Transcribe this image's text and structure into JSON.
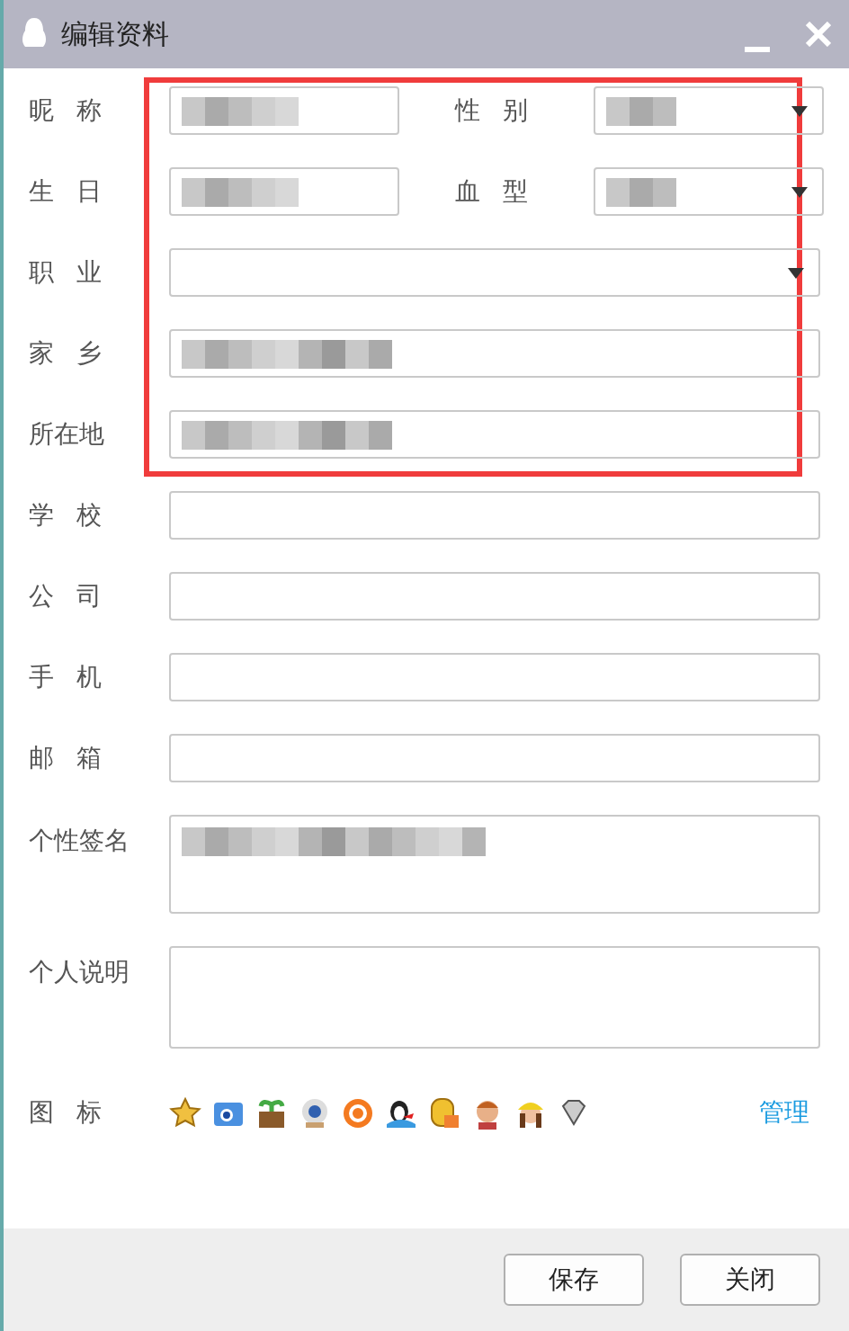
{
  "window": {
    "title": "编辑资料"
  },
  "highlight": true,
  "rows": [
    {
      "fields": [
        {
          "label": "昵 称",
          "kind": "text",
          "obscured": true
        },
        {
          "label": "性 别",
          "kind": "select",
          "obscured": true
        }
      ]
    },
    {
      "fields": [
        {
          "label": "生 日",
          "kind": "text",
          "obscured": true
        },
        {
          "label": "血 型",
          "kind": "select",
          "obscured": true
        }
      ]
    },
    {
      "fields": [
        {
          "label": "职 业",
          "kind": "select",
          "obscured": false
        }
      ]
    },
    {
      "fields": [
        {
          "label": "家 乡",
          "kind": "text",
          "obscured": true
        }
      ]
    },
    {
      "fields": [
        {
          "label": "所在地",
          "kind": "text",
          "obscured": true
        }
      ]
    },
    {
      "fields": [
        {
          "label": "学 校",
          "kind": "text",
          "obscured": false
        }
      ]
    },
    {
      "fields": [
        {
          "label": "公 司",
          "kind": "text",
          "obscured": false
        }
      ]
    },
    {
      "fields": [
        {
          "label": "手 机",
          "kind": "text",
          "obscured": false
        }
      ]
    },
    {
      "fields": [
        {
          "label": "邮 箱",
          "kind": "text",
          "obscured": false
        }
      ]
    },
    {
      "fields": [
        {
          "label": "个性签名",
          "kind": "textarea",
          "obscured": true
        }
      ]
    },
    {
      "fields": [
        {
          "label": "个人说明",
          "kind": "textarea",
          "obscured": false
        }
      ]
    }
  ],
  "icons": {
    "label": "图 标",
    "manage_link": "管理"
  },
  "buttons": [
    {
      "label": "保存"
    },
    {
      "label": "关闭"
    }
  ]
}
